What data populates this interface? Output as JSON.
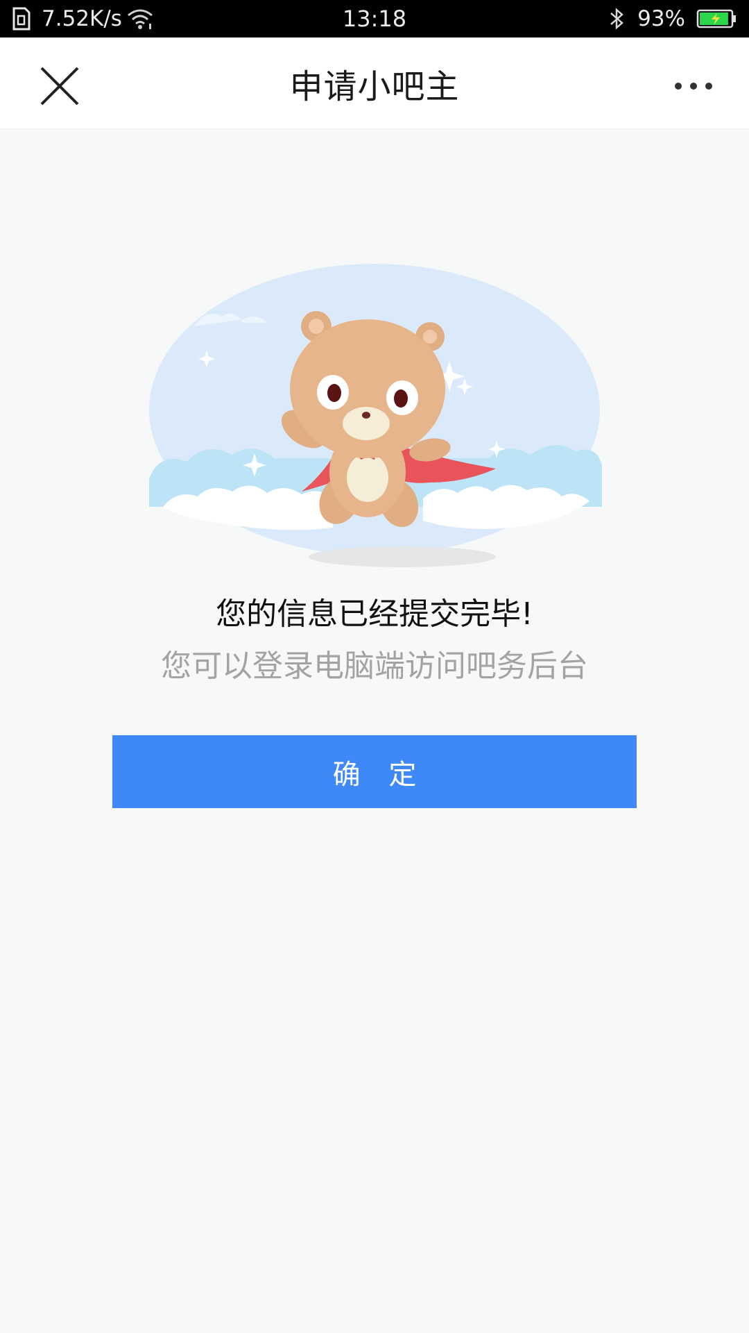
{
  "status_bar": {
    "net_speed": "7.52K/s",
    "time": "13:18",
    "battery_percent": "93%",
    "battery_level": 0.93,
    "battery_color": "#2bd64b"
  },
  "nav": {
    "title": "申请小吧主",
    "close_icon": "close-icon",
    "more_icon": "more-dots-icon"
  },
  "content": {
    "headline": "您的信息已经提交完毕!",
    "subline": "您可以登录电脑端访问吧务后台",
    "confirm_label": "确 定"
  },
  "colors": {
    "accent": "#3f88f7",
    "background": "#f7f8f8"
  }
}
